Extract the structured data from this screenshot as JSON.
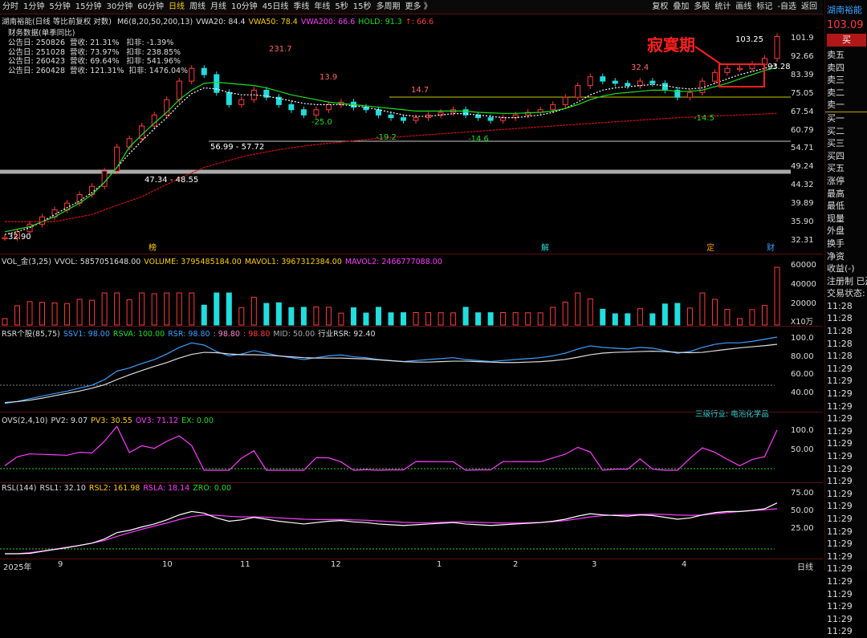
{
  "topbar": {
    "periods": [
      "分时",
      "1分钟",
      "5分钟",
      "15分钟",
      "30分钟",
      "60分钟",
      "日线",
      "周线",
      "月线",
      "10分钟",
      "45日线",
      "季线",
      "年线",
      "5秒",
      "15秒",
      "多周期",
      "更多 》"
    ],
    "active_period": "日线",
    "tools": [
      "复权",
      "叠加",
      "多股",
      "统计",
      "画线",
      "标记",
      "-自选",
      "返回"
    ]
  },
  "price_pane": {
    "title": "湖南裕能(日线 等比前复权 对数)",
    "indicators": [
      {
        "text": "M6(8,20,50,200,13)",
        "color": "#dddddd"
      },
      {
        "text": "VWA20: 84.4",
        "color": "#dddddd"
      },
      {
        "text": "VWA50: 78.4",
        "color": "#ffcc00"
      },
      {
        "text": "VWA200: 66.6",
        "color": "#ff3bff"
      },
      {
        "text": "HOLD: 91.3",
        "color": "#22dd22"
      },
      {
        "text": "↑: 66.6",
        "color": "#ff3b3b"
      }
    ],
    "fin_title": "财务数据(单季同比)",
    "fin_rows": [
      "公告日: 250826  营收: 21.31%   扣非: -1.39%",
      "公告日: 251028  营收: 73.97%   扣非: 238.85%",
      "公告日: 260423  营收: 69.64%   扣非: 541.96%",
      "公告日: 260428  营收: 121.31%  扣非: 1476.04%"
    ],
    "annotation": "寂寞期",
    "labels": {
      "high_231": "231.7",
      "l139": "13.9",
      "l147": "14.7",
      "l324": "32.4",
      "l10325": "103.25",
      "l9328": "93.28",
      "lm250": "-25.0",
      "lm192": "-19.2",
      "lm146": "-14.6",
      "lm145": "-14.5",
      "range1": "56.99 - 57.72",
      "range2": "47.34 - 48.55",
      "low3290": "32.90"
    },
    "event_marks": [
      "榜",
      "解",
      "定",
      "财"
    ],
    "yaxis": [
      "101.9",
      "92.66",
      "83.39",
      "75.05",
      "67.54",
      "60.79",
      "54.71",
      "49.24",
      "44.32",
      "39.89",
      "35.90",
      "32.31"
    ]
  },
  "volume_pane": {
    "indicators": [
      {
        "text": "VOL_金(3,25)",
        "color": "#dddddd"
      },
      {
        "text": "VVOL: 5857051648.00",
        "color": "#dddddd"
      },
      {
        "text": "VOLUME: 3795485184.00",
        "color": "#ffcc00"
      },
      {
        "text": "MAVOL1: 3967312384.00",
        "color": "#ffcc00"
      },
      {
        "text": "MAVOL2: 2466777088.00",
        "color": "#ff3bff"
      }
    ],
    "yaxis": [
      "60000",
      "40000",
      "20000"
    ],
    "unit": "X10万"
  },
  "rsr_pane": {
    "indicators": [
      {
        "text": "RSR个股(85,75)",
        "color": "#dddddd"
      },
      {
        "text": "SSV1: 98.00",
        "color": "#3aa0ff"
      },
      {
        "text": "RSVA: 100.00",
        "color": "#22dd22"
      },
      {
        "text": "RSR: 98.80",
        "color": "#3aa0ff"
      },
      {
        "text": ": 98.80",
        "color": "#ff88cc"
      },
      {
        "text": ": 98.80",
        "color": "#ff3b3b"
      },
      {
        "text": "MID: 50.00",
        "color": "#aaaaaa"
      },
      {
        "text": "行业RSR: 92.40",
        "color": "#dddddd"
      }
    ],
    "industry": "三级行业: 电池化学品",
    "yaxis": [
      "100.0",
      "80.00",
      "60.00",
      "40.00"
    ]
  },
  "ovs_pane": {
    "indicators": [
      {
        "text": "OVS(2,4,10)",
        "color": "#dddddd"
      },
      {
        "text": "PV2: 9.07",
        "color": "#dddddd"
      },
      {
        "text": "PV3: 30.55",
        "color": "#ffcc00"
      },
      {
        "text": "OV3: 71.12",
        "color": "#ff3bff"
      },
      {
        "text": "EX: 0.00",
        "color": "#22dd22"
      }
    ],
    "yaxis": [
      "100.0",
      "50.00"
    ]
  },
  "rsl_pane": {
    "indicators": [
      {
        "text": "RSL(144)",
        "color": "#dddddd"
      },
      {
        "text": "RSL1: 32.10",
        "color": "#dddddd"
      },
      {
        "text": "RSL2: 161.98",
        "color": "#ffcc00"
      },
      {
        "text": "RSLA: 18.14",
        "color": "#ff3bff"
      },
      {
        "text": "ZRO: 0.00",
        "color": "#22dd22"
      }
    ],
    "yaxis": [
      "75.00",
      "50.00",
      "25.00"
    ]
  },
  "xaxis": {
    "labels": [
      "2025年",
      "9",
      "10",
      "11",
      "12",
      "1",
      "2",
      "3",
      "4"
    ],
    "period": "日线"
  },
  "right_panel": {
    "name": "湖南裕能",
    "price": "103.09",
    "buy": "买",
    "rows": [
      "卖五",
      "卖四",
      "卖三",
      "卖二",
      "卖一",
      "买一",
      "买二",
      "买三",
      "买四",
      "买五",
      "涨停",
      "最高",
      "最低",
      "现量",
      "外盘",
      "换手",
      "净资",
      "收益(-)",
      "注册制 已盈",
      "交易状态: 正",
      "11:28",
      "11:28",
      "11:28",
      "11:28",
      "11:28",
      "11:29",
      "11:29",
      "11:29",
      "11:29",
      "11:29",
      "11:29",
      "11:29",
      "11:29",
      "11:29",
      "11:29",
      "11:29",
      "11:29",
      "11:29",
      "11:29",
      "11:29",
      "11:29",
      "11:29",
      "11:29",
      "11:29",
      "11:29",
      "11:29",
      "11:29"
    ]
  },
  "chart_data": {
    "type": "line",
    "title": "湖南裕能(日线 等比前复权 对数)",
    "x": [
      "2025-08",
      "2025-09",
      "2025-10",
      "2025-11",
      "2025-12",
      "2026-01",
      "2026-02",
      "2026-03",
      "2026-04"
    ],
    "x_ticks": [
      "2025年",
      "9",
      "10",
      "11",
      "12",
      "1",
      "2",
      "3",
      "4"
    ],
    "series": [
      {
        "name": "close",
        "color": "#22dddd",
        "values": [
          32.9,
          34.0,
          35.5,
          37.0,
          38.5,
          40.0,
          42.0,
          44.0,
          48.0,
          55.0,
          57.7,
          62.0,
          66.0,
          72.0,
          80.0,
          86.0,
          83.0,
          75.0,
          70.0,
          72.0,
          76.0,
          73.0,
          70.0,
          68.0,
          66.0,
          68.0,
          70.0,
          71.0,
          69.0,
          68.0,
          66.0,
          65.0,
          64.0,
          65.0,
          66.0,
          67.0,
          68.0,
          66.0,
          65.0,
          64.0,
          65.0,
          66.0,
          67.0,
          68.0,
          70.0,
          73.0,
          78.0,
          82.0,
          80.0,
          79.0,
          78.0,
          80.0,
          79.0,
          76.0,
          73.0,
          75.0,
          80.0,
          84.0,
          86.0,
          86.0,
          88.0,
          91.0,
          103.09
        ]
      },
      {
        "name": "VWA20",
        "color": "#ffffff",
        "values": [
          33.5,
          34.0,
          34.8,
          36.0,
          37.5,
          39.0,
          40.5,
          42.5,
          45.0,
          49.0,
          53.0,
          57.0,
          61.0,
          65.0,
          70.0,
          74.5,
          77.0,
          76.5,
          75.0,
          74.0,
          74.0,
          73.5,
          72.5,
          71.5,
          70.5,
          70.0,
          70.0,
          70.0,
          69.5,
          69.0,
          68.0,
          67.0,
          66.0,
          65.5,
          65.5,
          66.0,
          66.5,
          66.5,
          66.0,
          65.5,
          65.0,
          65.0,
          65.5,
          66.0,
          67.0,
          68.5,
          71.0,
          74.0,
          76.0,
          77.0,
          77.5,
          78.0,
          78.5,
          78.0,
          77.0,
          76.5,
          77.0,
          79.0,
          81.0,
          83.0,
          84.5,
          86.0,
          88.0
        ]
      },
      {
        "name": "VWA50",
        "color": "#22dd22",
        "values": [
          34.0,
          34.5,
          35.0,
          36.0,
          37.0,
          38.5,
          40.0,
          42.0,
          45.0,
          49.0,
          55.0,
          59.0,
          63.0,
          67.0,
          72.0,
          76.0,
          79.0,
          79.5,
          79.0,
          78.5,
          78.0,
          77.0,
          75.5,
          74.0,
          73.0,
          72.0,
          71.0,
          70.5,
          70.0,
          69.5,
          69.0,
          68.5,
          68.0,
          67.5,
          67.5,
          67.5,
          67.5,
          67.5,
          67.0,
          66.8,
          66.6,
          66.6,
          66.8,
          67.0,
          67.5,
          68.5,
          70.0,
          72.0,
          73.5,
          74.5,
          75.0,
          75.5,
          76.0,
          76.0,
          75.5,
          75.5,
          76.0,
          77.5,
          79.0,
          81.0,
          83.0,
          85.0,
          86.5
        ]
      },
      {
        "name": "VWA200",
        "color": "#cc1010",
        "values": [
          36.0,
          36.0,
          36.0,
          36.0,
          36.0,
          36.5,
          37.0,
          37.5,
          38.5,
          39.5,
          40.5,
          41.5,
          43.0,
          44.5,
          46.0,
          47.5,
          49.0,
          50.0,
          51.0,
          52.0,
          52.8,
          53.5,
          54.2,
          54.8,
          55.3,
          55.8,
          56.2,
          56.6,
          57.0,
          57.4,
          57.8,
          58.1,
          58.4,
          58.7,
          59.0,
          59.3,
          59.6,
          59.9,
          60.2,
          60.5,
          60.8,
          61.1,
          61.4,
          61.7,
          62.0,
          62.3,
          62.6,
          62.9,
          63.2,
          63.5,
          63.8,
          64.1,
          64.4,
          64.7,
          65.0,
          65.2,
          65.4,
          65.6,
          65.8,
          66.0,
          66.2,
          66.4,
          66.6
        ]
      }
    ],
    "ylim": [
      32.31,
      101.9
    ],
    "log_scale": true,
    "annotations": [
      "寂寞期",
      "231.7",
      "13.9",
      "14.7",
      "32.4",
      "103.25",
      "93.28",
      "-25.0",
      "-19.2",
      "-14.6",
      "-14.5",
      "56.99 - 57.72",
      "47.34 - 48.55",
      "32.90"
    ],
    "grid": false
  }
}
